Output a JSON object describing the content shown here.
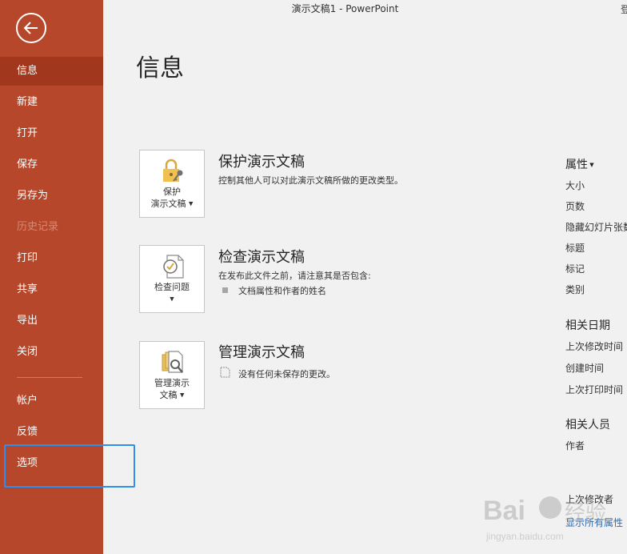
{
  "window": {
    "title": "演示文稿1  -  PowerPoint",
    "right_fragment": "登"
  },
  "sidebar": {
    "items": [
      {
        "label": "信息",
        "state": "active"
      },
      {
        "label": "新建"
      },
      {
        "label": "打开"
      },
      {
        "label": "保存"
      },
      {
        "label": "另存为"
      },
      {
        "label": "历史记录",
        "state": "disabled"
      },
      {
        "label": "打印"
      },
      {
        "label": "共享"
      },
      {
        "label": "导出"
      },
      {
        "label": "关闭"
      },
      {
        "label": "帐户"
      },
      {
        "label": "反馈"
      },
      {
        "label": "选项"
      }
    ]
  },
  "page": {
    "title": "信息"
  },
  "sections": {
    "protect": {
      "button_line1": "保护",
      "button_line2": "演示文稿",
      "title": "保护演示文稿",
      "desc": "控制其他人可以对此演示文稿所做的更改类型。"
    },
    "inspect": {
      "button_line1": "检查问题",
      "title": "检查演示文稿",
      "desc": "在发布此文件之前，请注意其是否包含:",
      "items": [
        "文档属性和作者的姓名"
      ]
    },
    "manage": {
      "button_line1": "管理演示",
      "button_line2": "文稿",
      "title": "管理演示文稿",
      "desc": "没有任何未保存的更改。"
    }
  },
  "properties": {
    "header": "属性",
    "items": [
      "大小",
      "页数",
      "隐藏幻灯片张数",
      "标题",
      "标记",
      "类别"
    ],
    "dates_header": "相关日期",
    "dates": [
      "上次修改时间",
      "创建时间",
      "上次打印时间"
    ],
    "people_header": "相关人员",
    "people": [
      "作者"
    ],
    "last_modified_by": "上次修改者",
    "show_all": "显示所有属性"
  },
  "colors": {
    "sidebar": "#b7472a",
    "sidebar_active": "#a1371d",
    "highlight": "#2e8ef0",
    "link": "#2a6bb5"
  }
}
